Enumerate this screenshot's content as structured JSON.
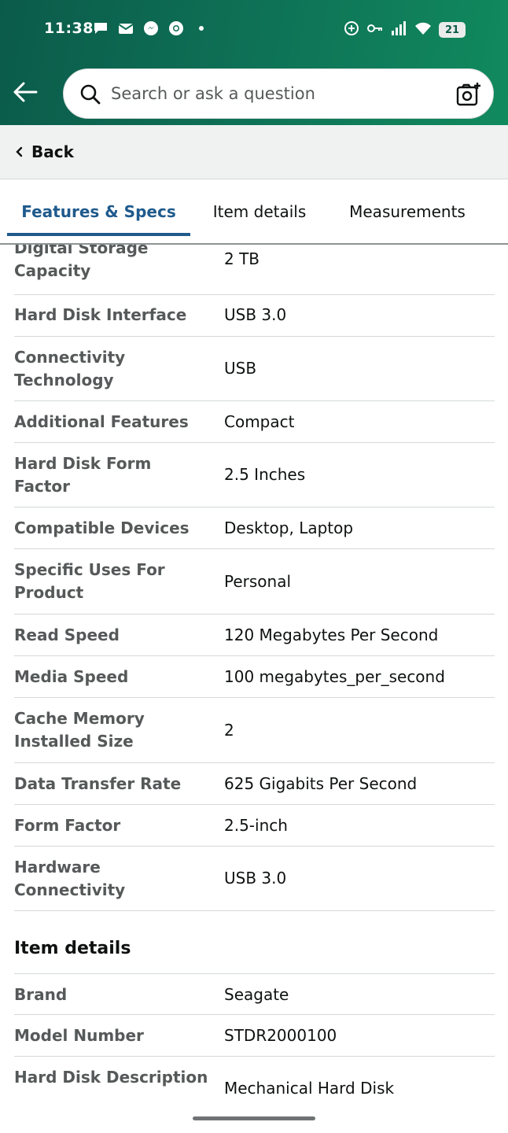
{
  "status_bar": {
    "time": "11:38",
    "battery": "21",
    "left_icons": [
      "chat-bubble-icon",
      "mail-icon",
      "messenger-icon",
      "chrome-icon",
      "dot-icon"
    ],
    "right_icons": [
      "sync-icon",
      "key-icon",
      "signal-icon",
      "wifi-icon",
      "battery-icon"
    ]
  },
  "search": {
    "placeholder": "Search or ask a question"
  },
  "back_bar": {
    "label": "Back"
  },
  "tabs": [
    {
      "label": "Features & Specs",
      "active": true
    },
    {
      "label": "Item details",
      "active": false
    },
    {
      "label": "Measurements",
      "active": false
    }
  ],
  "specs": [
    {
      "label": "Digital Storage Capacity",
      "value": "2 TB"
    },
    {
      "label": "Hard Disk Interface",
      "value": "USB 3.0"
    },
    {
      "label": "Connectivity Technology",
      "value": "USB"
    },
    {
      "label": "Additional Features",
      "value": "Compact"
    },
    {
      "label": "Hard Disk Form Factor",
      "value": "2.5 Inches"
    },
    {
      "label": "Compatible Devices",
      "value": "Desktop, Laptop"
    },
    {
      "label": "Specific Uses For Product",
      "value": "Personal"
    },
    {
      "label": "Read Speed",
      "value": "120 Megabytes Per Second"
    },
    {
      "label": "Media Speed",
      "value": "100 megabytes_per_second"
    },
    {
      "label": "Cache Memory Installed Size",
      "value": "2"
    },
    {
      "label": "Data Transfer Rate",
      "value": "625 Gigabits Per Second"
    },
    {
      "label": "Form Factor",
      "value": "2.5-inch"
    },
    {
      "label": "Hardware Connectivity",
      "value": "USB 3.0"
    }
  ],
  "item_details": {
    "title": "Item details",
    "rows": [
      {
        "label": "Brand",
        "value": "Seagate"
      },
      {
        "label": "Model Number",
        "value": "STDR2000100"
      },
      {
        "label": "Hard Disk Description",
        "value": "Mechanical Hard Disk"
      }
    ]
  },
  "colors": {
    "header_green": "#0e6f55",
    "active_tab": "#1f5a8c",
    "label_gray": "#565959"
  }
}
